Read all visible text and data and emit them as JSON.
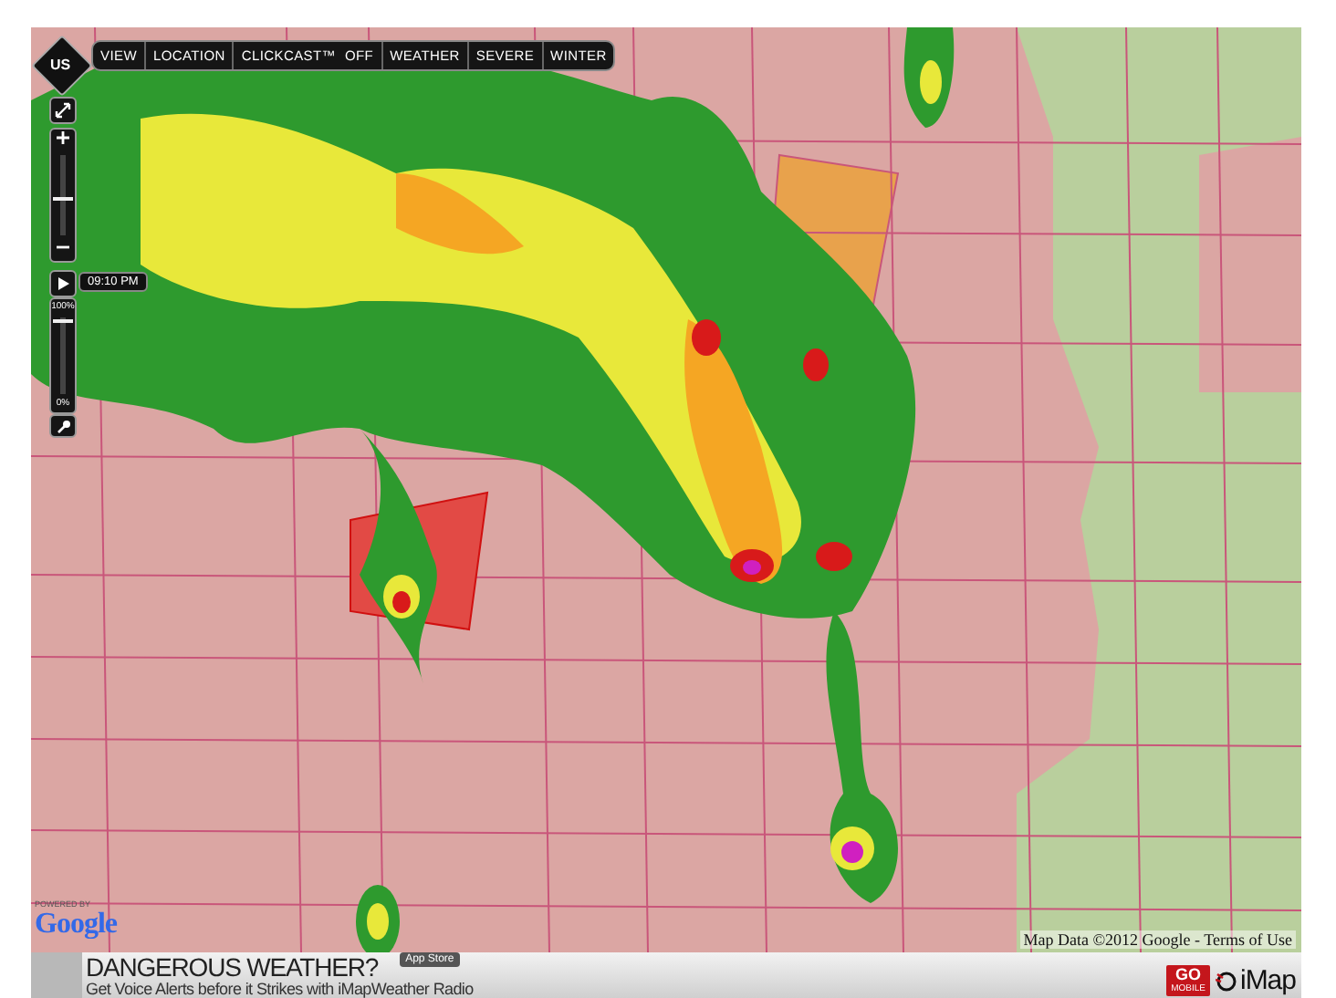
{
  "nav": {
    "label": "US"
  },
  "toolbar": [
    {
      "label": "VIEW",
      "kind": "menu"
    },
    {
      "label": "LOCATION",
      "kind": "menu"
    },
    {
      "label": "CLICKCAST™",
      "kind": "toggle",
      "state": "OFF"
    },
    {
      "label": "WEATHER",
      "kind": "menu"
    },
    {
      "label": "SEVERE",
      "kind": "menu"
    },
    {
      "label": "WINTER",
      "kind": "menu"
    }
  ],
  "zoom": {
    "level": 0.45
  },
  "playback": {
    "time": "09:10 PM"
  },
  "opacity": {
    "top_label": "100%",
    "bottom_label": "0%",
    "level": 0.97
  },
  "attribution": {
    "powered_by": "POWERED BY",
    "logo": "Google",
    "text": "Map Data ©2012 Google - Terms of Use"
  },
  "ad": {
    "title": "DANGEROUS WEATHER?",
    "subtitle": "Get Voice Alerts before it Strikes with iMapWeather Radio",
    "store_badge": "App Store",
    "go_label": "GO",
    "mobile_label": "MOBILE",
    "brand": "iMap"
  }
}
